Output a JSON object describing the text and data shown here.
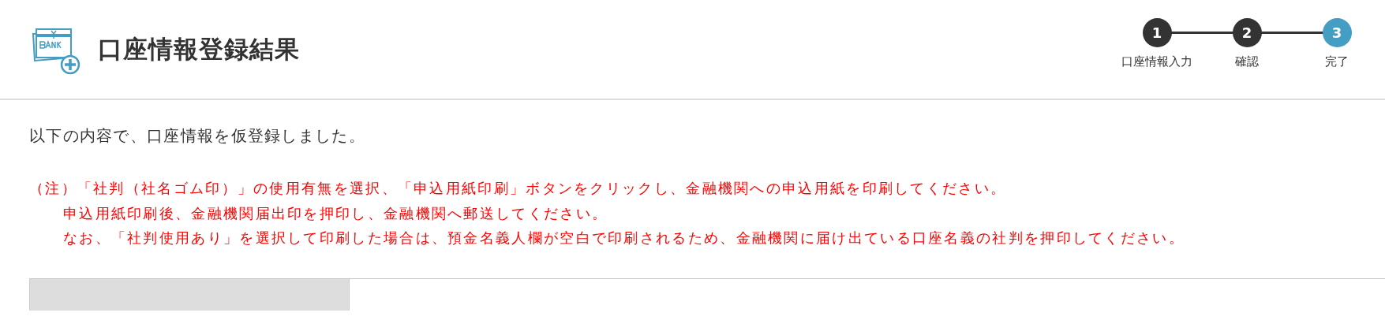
{
  "header": {
    "title": "口座情報登録結果"
  },
  "steps": [
    {
      "number": "1",
      "label": "口座情報入力",
      "selected": false
    },
    {
      "number": "2",
      "label": "確認",
      "selected": false
    },
    {
      "number": "3",
      "label": "完了",
      "selected": true
    }
  ],
  "message": "以下の内容で、口座情報を仮登録しました。",
  "notes": [
    "（注）「社判（社名ゴム印）」の使用有無を選択、「申込用紙印刷」ボタンをクリックし、金融機関への申込用紙を印刷してください。",
    "申込用紙印刷後、金融機関届出印を押印し、金融機関へ郵送してください。",
    "なお、「社判使用あり」を選択して印刷した場合は、預金名義人欄が空白で印刷されるため、金融機関に届け出ている口座名義の社判を押印してください。"
  ]
}
